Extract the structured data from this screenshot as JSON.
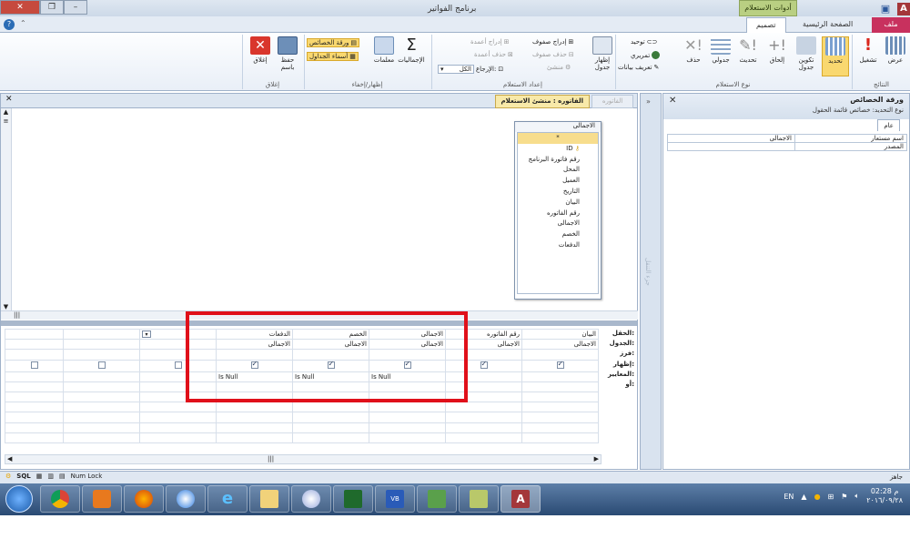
{
  "window": {
    "title": "برنامج الفواتير",
    "context_group": "أدوات الاستعلام"
  },
  "tabs": {
    "file": "ملف",
    "home": "الصفحة الرئيسية",
    "design": "تصميم"
  },
  "ribbon": {
    "results": {
      "label": "النتائج",
      "view": "عرض",
      "run": "تشغيل"
    },
    "query_type": {
      "label": "نوع الاستعلام",
      "select": "تحديد",
      "make_table": "تكوين جدول",
      "append": "إلحاق",
      "update": "تحديث",
      "crosstab": "جدولي",
      "delete": "حذف",
      "union": "توحيد",
      "pass_through": "تمريري",
      "data_definition": "تعريف بيانات"
    },
    "query_setup": {
      "label": "إعداد الاستعلام",
      "show_table": "إظهار جدول",
      "insert_rows": "إدراج صفوف",
      "delete_rows": "حذف صفوف",
      "builder": "منشئ",
      "insert_columns": "إدراج أعمدة",
      "delete_columns": "حذف أعمدة",
      "return": "الإرجاع:",
      "return_value": "الكل"
    },
    "show_hide": {
      "label": "إظهار/إخفاء",
      "totals": "الإجماليات",
      "parameters": "معلمات",
      "property_sheet": "ورقة الخصائص",
      "table_names": "أسماء الجداول"
    },
    "close": {
      "label": "إغلاق",
      "save_as": "حفظ باسم",
      "close": "إغلاق"
    }
  },
  "property_sheet": {
    "title": "ورقة الخصائص",
    "selection_type": "نوع التحديد: خصائص قائمة الحقول",
    "tab": "عام",
    "rows": [
      {
        "name": "اسم مستعار",
        "value": "الاجمالى"
      },
      {
        "name": "المصدر",
        "value": ""
      }
    ]
  },
  "nav_pane": {
    "label": "جزء التنقل"
  },
  "document": {
    "query_tab": "الفاتوره : منشئ الاستعلام",
    "form_tab": "الفاتوره"
  },
  "table_box": {
    "title": "الاجمالى",
    "fields": [
      "*",
      "ID",
      "رقم فاتورة البرنامج",
      "المحل",
      "العميل",
      "التاريخ",
      "البيان",
      "رقم الفاتوره",
      "الاجمالى",
      "الخصم",
      "الدفعات"
    ]
  },
  "grid": {
    "row_labels": [
      "الحقل:",
      "الجدول:",
      "فرز:",
      "إظهار:",
      "المعايير:",
      "أو:"
    ],
    "columns": [
      {
        "field": "البيان",
        "table": "الاجمالى",
        "show": true,
        "criteria": ""
      },
      {
        "field": "رقم الفاتوره",
        "table": "الاجمالى",
        "show": true,
        "criteria": ""
      },
      {
        "field": "الاجمالى",
        "table": "الاجمالى",
        "show": true,
        "criteria": "Is Null"
      },
      {
        "field": "الخصم",
        "table": "الاجمالى",
        "show": true,
        "criteria": "Is Null"
      },
      {
        "field": "الدفعات",
        "table": "الاجمالى",
        "show": true,
        "criteria": "Is Null"
      },
      {
        "field": "",
        "table": "",
        "show": false,
        "criteria": ""
      },
      {
        "field": "",
        "table": "",
        "show": false,
        "criteria": ""
      },
      {
        "field": "",
        "table": "",
        "show": false,
        "criteria": ""
      }
    ]
  },
  "status_bar": {
    "ready": "جاهز",
    "num_lock": "Num Lock",
    "sql": "SQL"
  },
  "taskbar": {
    "lang": "EN",
    "time": "02:28 م",
    "date": "٢٠١٦/٠٩/٢٨"
  },
  "colors": {
    "file_tab": "#c8315e",
    "context_group": "#b9cf82",
    "highlight_box": "#e0101a",
    "selected_field": "#f7dd8d"
  }
}
